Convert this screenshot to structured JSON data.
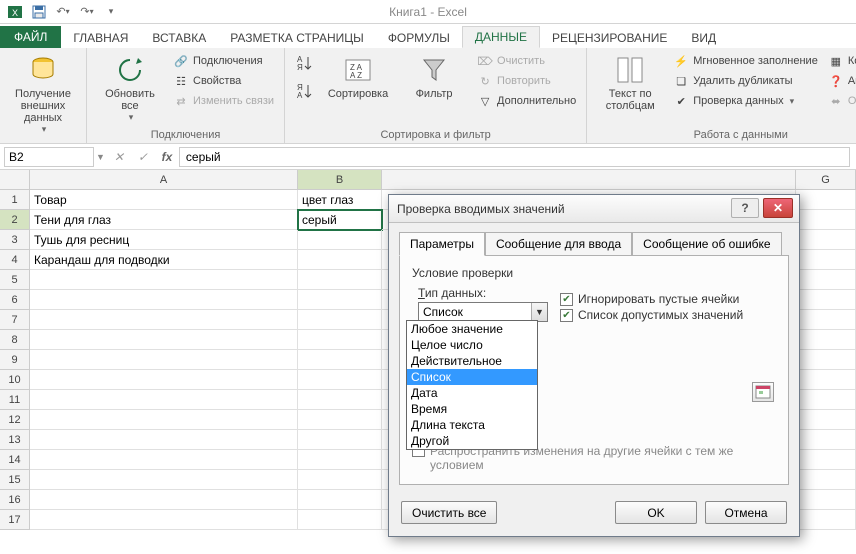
{
  "app_title": "Книга1 - Excel",
  "tabs": {
    "file": "ФАЙЛ",
    "home": "ГЛАВНАЯ",
    "insert": "ВСТАВКА",
    "layout": "РАЗМЕТКА СТРАНИЦЫ",
    "formulas": "ФОРМУЛЫ",
    "data": "ДАННЫЕ",
    "review": "РЕЦЕНЗИРОВАНИЕ",
    "view": "ВИД"
  },
  "ribbon": {
    "get_data": "Получение\nвнешних данных",
    "refresh_all": "Обновить\nвсе",
    "connections": "Подключения",
    "properties": "Свойства",
    "edit_links": "Изменить связи",
    "group_connections": "Подключения",
    "sort": "Сортировка",
    "filter": "Фильтр",
    "clear": "Очистить",
    "reapply": "Повторить",
    "advanced": "Дополнительно",
    "group_sortfilter": "Сортировка и фильтр",
    "text_to_cols": "Текст по\nстолбцам",
    "flash_fill": "Мгновенное заполнение",
    "remove_dupes": "Удалить дубликаты",
    "data_validation": "Проверка данных",
    "consolidate": "Консол",
    "whatif": "Анали",
    "relationships": "Отнош",
    "group_datatools": "Работа с данными"
  },
  "namebox": "B2",
  "formula_value": "серый",
  "columns": [
    "A",
    "B",
    "G"
  ],
  "col_widths": {
    "A": 268,
    "B": 84,
    "gap": 414,
    "G": 60
  },
  "rows": [
    {
      "n": 1,
      "A": "Товар",
      "B": "цвет глаз"
    },
    {
      "n": 2,
      "A": "Тени для глаз",
      "B": "серый"
    },
    {
      "n": 3,
      "A": "Тушь для ресниц",
      "B": ""
    },
    {
      "n": 4,
      "A": "Карандаш для подводки",
      "B": ""
    },
    {
      "n": 5,
      "A": "",
      "B": ""
    },
    {
      "n": 6,
      "A": "",
      "B": ""
    },
    {
      "n": 7,
      "A": "",
      "B": ""
    },
    {
      "n": 8,
      "A": "",
      "B": ""
    },
    {
      "n": 9,
      "A": "",
      "B": ""
    },
    {
      "n": 10,
      "A": "",
      "B": ""
    },
    {
      "n": 11,
      "A": "",
      "B": ""
    },
    {
      "n": 12,
      "A": "",
      "B": ""
    },
    {
      "n": 13,
      "A": "",
      "B": ""
    },
    {
      "n": 14,
      "A": "",
      "B": ""
    },
    {
      "n": 15,
      "A": "",
      "B": ""
    },
    {
      "n": 16,
      "A": "",
      "B": ""
    },
    {
      "n": 17,
      "A": "",
      "B": ""
    }
  ],
  "dialog": {
    "title": "Проверка вводимых значений",
    "tabs": {
      "params": "Параметры",
      "input_msg": "Сообщение для ввода",
      "error_msg": "Сообщение об ошибке"
    },
    "cond_title": "Условие проверки",
    "type_label": "Тип данных:",
    "type_value": "Список",
    "type_options": [
      "Любое значение",
      "Целое число",
      "Действительное",
      "Список",
      "Дата",
      "Время",
      "Длина текста",
      "Другой"
    ],
    "ignore_blank": "Игнорировать пустые ячейки",
    "list_dropdown": "Список допустимых значений",
    "apply_others": "Распространить изменения на другие ячейки с тем же условием",
    "clear_all": "Очистить все",
    "ok": "OK",
    "cancel": "Отмена"
  }
}
